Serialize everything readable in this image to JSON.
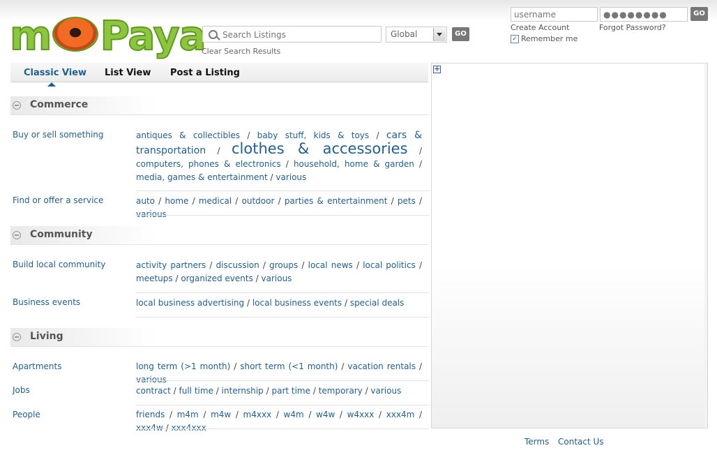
{
  "logo": {
    "left": "m",
    "right": "Paya"
  },
  "search": {
    "placeholder": "Search Listings",
    "scope": "Global",
    "go": "GO",
    "clear": "Clear Search Results"
  },
  "login": {
    "username": "username",
    "password": "●●●●●●●●",
    "go": "GO",
    "create": "Create Account",
    "forgot": "Forgot Password?",
    "remember": "Remember me"
  },
  "tabs": [
    "Classic View",
    "List View",
    "Post a Listing"
  ],
  "sections": [
    {
      "title": "Commerce",
      "rows": [
        {
          "label": "Buy or sell something",
          "links": [
            "antiques & collectibles",
            "baby stuff, kids & toys",
            "cars & transportation",
            "clothes & accessories",
            "computers, phones & electronics",
            "household, home & garden",
            "media, games & entertainment",
            "various"
          ]
        },
        {
          "label": "Find or offer a service",
          "links": [
            "auto",
            "home",
            "medical",
            "outdoor",
            "parties & entertainment",
            "pets",
            "various"
          ]
        }
      ]
    },
    {
      "title": "Community",
      "rows": [
        {
          "label": "Build local community",
          "links": [
            "activity partners",
            "discussion",
            "groups",
            "local news",
            "local politics",
            "meetups",
            "organized events",
            "various"
          ]
        },
        {
          "label": "Business events",
          "links": [
            "local business advertising",
            "local business events",
            "special deals"
          ]
        }
      ]
    },
    {
      "title": "Living",
      "rows": [
        {
          "label": "Apartments",
          "links": [
            "long term (>1 month)",
            "short term (<1 month)",
            "vacation rentals",
            "various"
          ]
        },
        {
          "label": "Jobs",
          "links": [
            "contract",
            "full time",
            "internship",
            "part time",
            "temporary",
            "various"
          ]
        },
        {
          "label": "People",
          "links": [
            "friends",
            "m4m",
            "m4w",
            "m4xxx",
            "w4m",
            "w4w",
            "w4xxx",
            "xxx4m",
            "xxx4w",
            "xxx4xxx"
          ]
        }
      ]
    }
  ],
  "footer": {
    "terms": "Terms",
    "contact": "Contact Us"
  }
}
